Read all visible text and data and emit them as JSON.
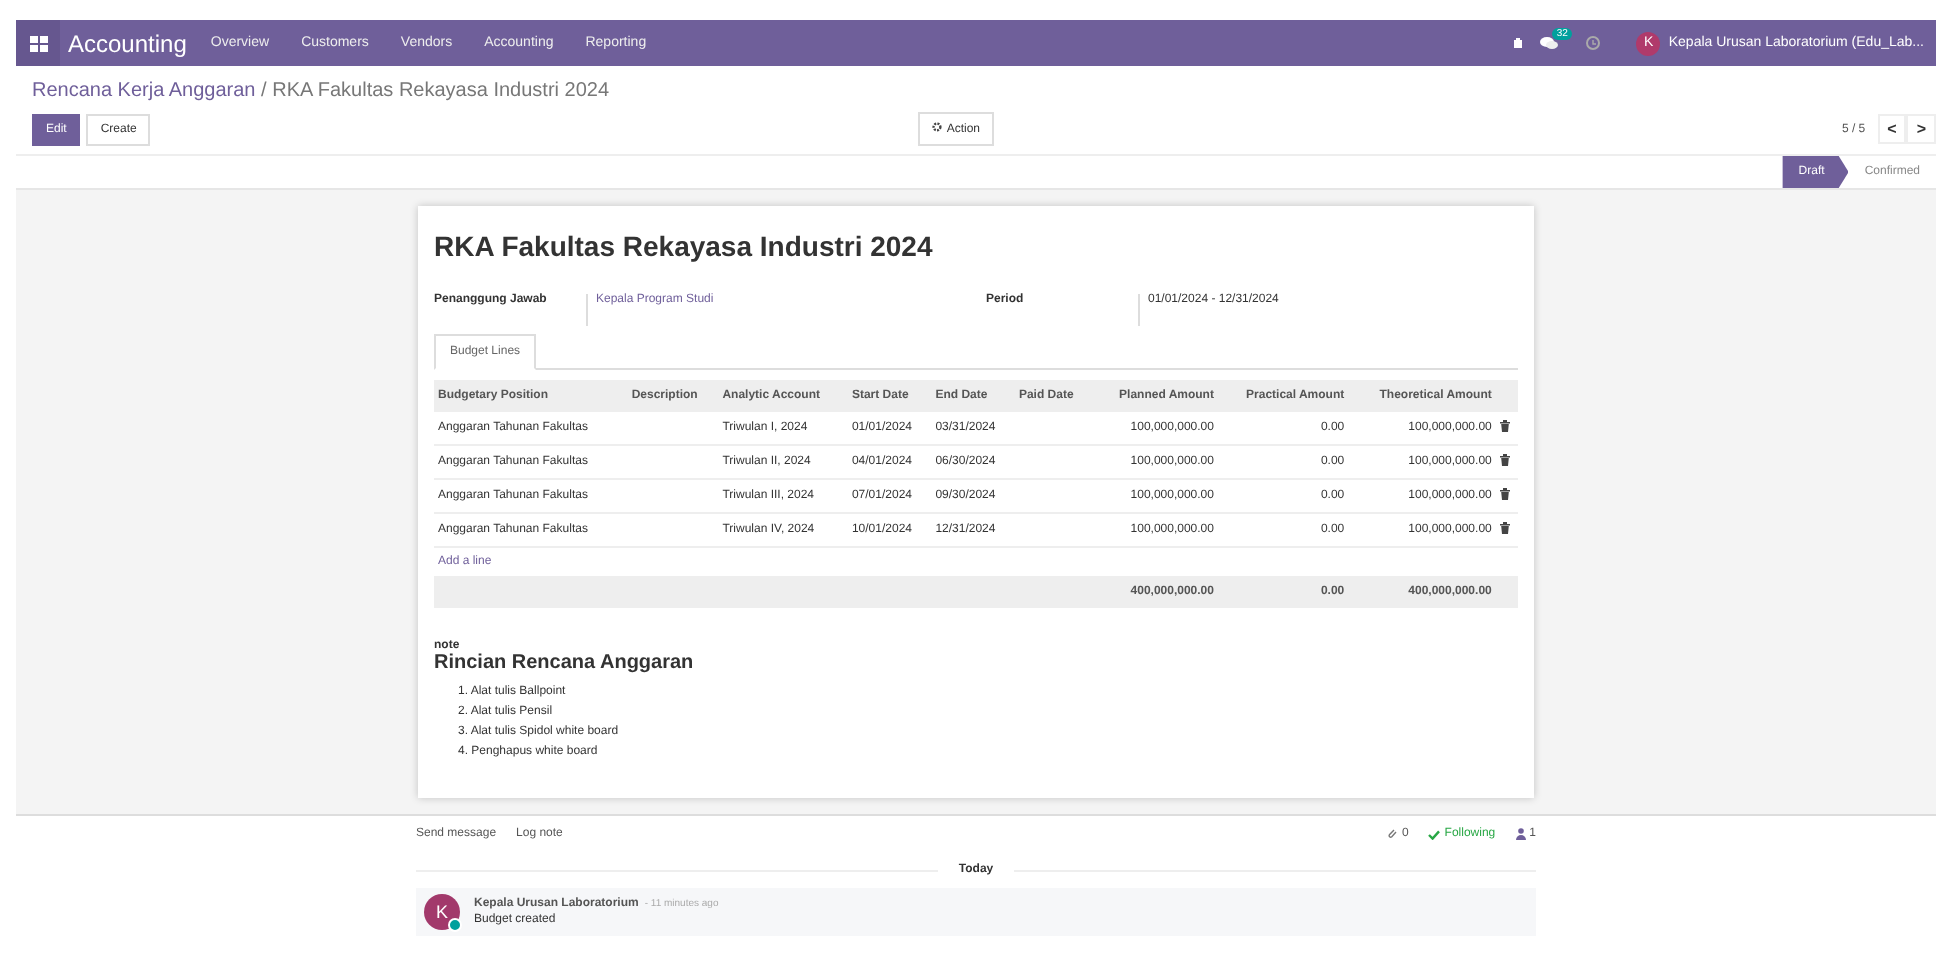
{
  "navbar": {
    "app": "Accounting",
    "menus": [
      "Overview",
      "Customers",
      "Vendors",
      "Accounting",
      "Reporting"
    ],
    "chat_badge": "32",
    "user_initial": "K",
    "user": "Kepala Urusan Laboratorium (Edu_Lab..."
  },
  "breadcrumb": {
    "parent": "Rencana Kerja Anggaran",
    "separator": "/",
    "current": "RKA Fakultas Rekayasa Industri 2024"
  },
  "buttons": {
    "edit": "Edit",
    "create": "Create",
    "action": "Action"
  },
  "pager": {
    "value": "5 / 5",
    "prev": "<",
    "next": ">"
  },
  "stages": [
    {
      "label": "Draft",
      "selected": true
    },
    {
      "label": "Confirmed",
      "selected": false
    }
  ],
  "sheet": {
    "title": "RKA Fakultas Rekayasa Industri 2024",
    "fields": [
      {
        "label": "Penanggung Jawab",
        "value": "Kepala Program Studi",
        "kind": "link"
      },
      {
        "label": "Period",
        "value": "01/01/2024 - 12/31/2024",
        "kind": "text"
      }
    ],
    "tabs": [
      {
        "label": "Budget Lines",
        "selected": true
      }
    ],
    "table": {
      "columns": [
        "Budgetary Position",
        "Description",
        "Analytic Account",
        "Start Date",
        "End Date",
        "Paid Date",
        "Planned Amount",
        "Practical Amount",
        "Theoretical Amount"
      ],
      "rows": [
        [
          "Anggaran Tahunan Fakultas",
          "",
          "Triwulan I, 2024",
          "01/01/2024",
          "03/31/2024",
          "",
          "100,000,000.00",
          "0.00",
          "100,000,000.00"
        ],
        [
          "Anggaran Tahunan Fakultas",
          "",
          "Triwulan II, 2024",
          "04/01/2024",
          "06/30/2024",
          "",
          "100,000,000.00",
          "0.00",
          "100,000,000.00"
        ],
        [
          "Anggaran Tahunan Fakultas",
          "",
          "Triwulan III, 2024",
          "07/01/2024",
          "09/30/2024",
          "",
          "100,000,000.00",
          "0.00",
          "100,000,000.00"
        ],
        [
          "Anggaran Tahunan Fakultas",
          "",
          "Triwulan IV, 2024",
          "10/01/2024",
          "12/31/2024",
          "",
          "100,000,000.00",
          "0.00",
          "100,000,000.00"
        ]
      ],
      "add_line": "Add a line",
      "totals": [
        "400,000,000.00",
        "0.00",
        "400,000,000.00"
      ]
    },
    "note": {
      "label": "note",
      "heading": "Rincian Rencana Anggaran",
      "items": [
        "1. Alat tulis Ballpoint",
        "2. Alat tulis Pensil",
        "3. Alat tulis Spidol white board",
        "4. Penghapus white board"
      ]
    }
  },
  "chatter": {
    "send": "Send message",
    "log": "Log note",
    "attachments": "0",
    "following": "Following",
    "followers": "1",
    "divider": "Today",
    "messages": [
      {
        "initial": "K",
        "author": "Kepala Urusan Laboratorium",
        "time": "- 11 minutes ago",
        "body": "Budget created"
      }
    ]
  }
}
